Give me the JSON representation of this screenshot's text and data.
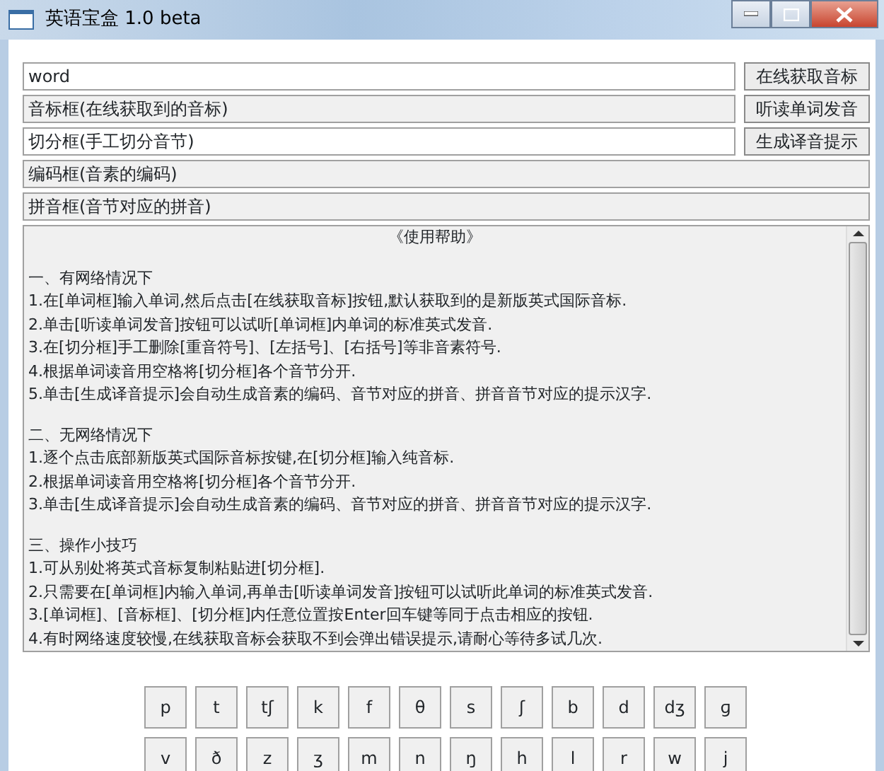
{
  "window": {
    "title": "英语宝盒 1.0 beta"
  },
  "fields": [
    {
      "kind": "input",
      "value": "word",
      "button": "在线获取音标"
    },
    {
      "kind": "readonly",
      "value": "音标框(在线获取到的音标)",
      "button": "听读单词发音"
    },
    {
      "kind": "input",
      "value": "切分框(手工切分音节)",
      "button": "生成译音提示"
    },
    {
      "kind": "readonly",
      "value": "编码框(音素的编码)"
    },
    {
      "kind": "readonly",
      "value": "拼音框(音节对应的拼音)"
    }
  ],
  "help": {
    "title": "《使用帮助》",
    "sections": [
      {
        "heading": "一、有网络情况下",
        "items": [
          "1.在[单词框]输入单词,然后点击[在线获取音标]按钮,默认获取到的是新版英式国际音标.",
          "2.单击[听读单词发音]按钮可以试听[单词框]内单词的标准英式发音.",
          "3.在[切分框]手工删除[重音符号]、[左括号]、[右括号]等非音素符号.",
          "4.根据单词读音用空格将[切分框]各个音节分开.",
          "5.单击[生成译音提示]会自动生成音素的编码、音节对应的拼音、拼音音节对应的提示汉字."
        ]
      },
      {
        "heading": "二、无网络情况下",
        "items": [
          "1.逐个点击底部新版英式国际音标按键,在[切分框]输入纯音标.",
          "2.根据单词读音用空格将[切分框]各个音节分开.",
          "3.单击[生成译音提示]会自动生成音素的编码、音节对应的拼音、拼音音节对应的提示汉字."
        ]
      },
      {
        "heading": "三、操作小技巧",
        "items": [
          "1.可从别处将英式音标复制粘贴进[切分框].",
          "2.只需要在[单词框]内输入单词,再单击[听读单词发音]按钮可以试听此单词的标准英式发音.",
          "3.[单词框]、[音标框]、[切分框]内任意位置按Enter回车键等同于点击相应的按钮.",
          "4.有时网络速度较慢,在线获取音标会获取不到会弹出错误提示,请耐心等待多试几次."
        ]
      }
    ]
  },
  "keyboard": [
    [
      "p",
      "t",
      "tʃ",
      "k",
      "f",
      "θ",
      "s",
      "ʃ",
      "b",
      "d",
      "dʒ",
      "ɡ"
    ],
    [
      "v",
      "ð",
      "z",
      "ʒ",
      "m",
      "n",
      "ŋ",
      "h",
      "l",
      "r",
      "w",
      "j"
    ]
  ]
}
